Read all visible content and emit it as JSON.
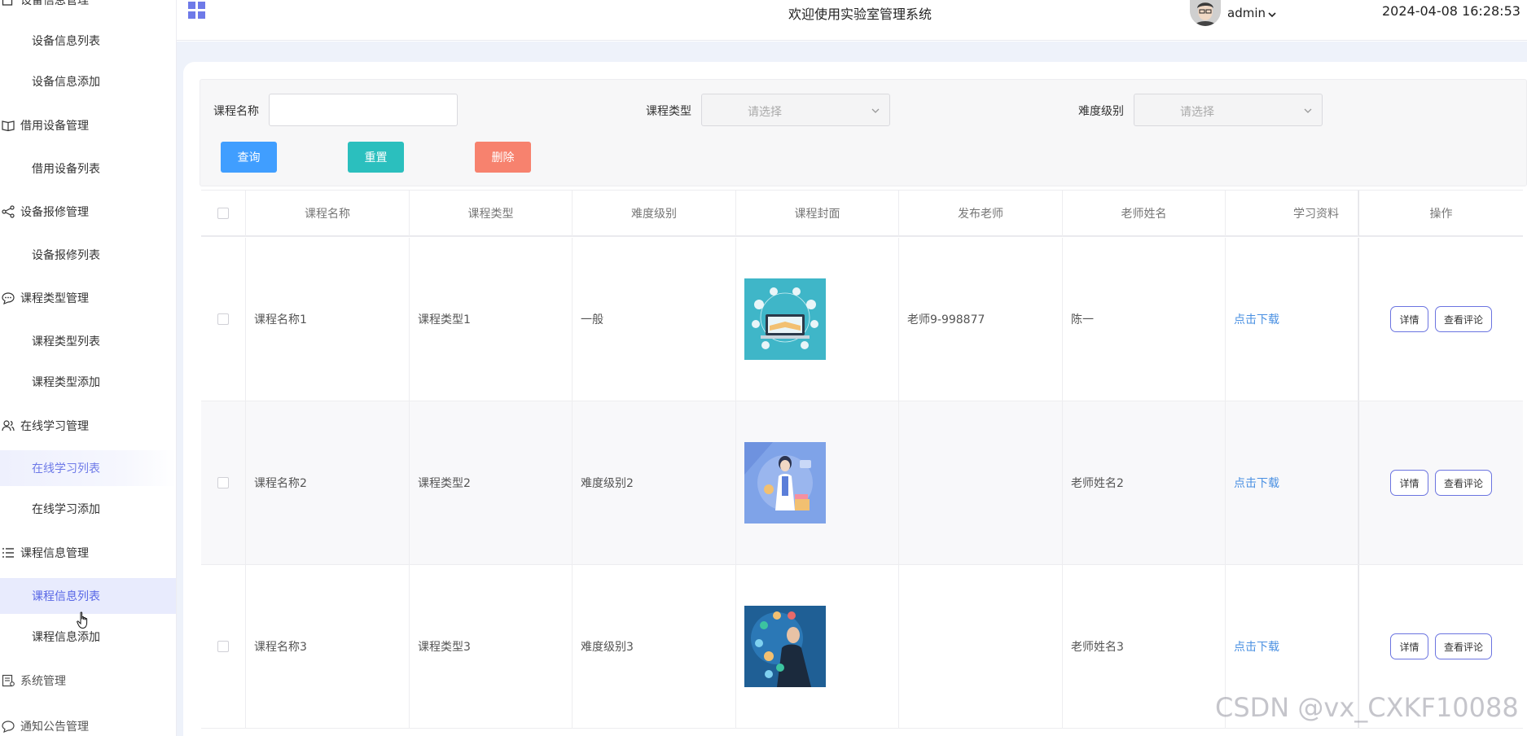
{
  "header": {
    "title": "欢迎使用实验室管理系统",
    "user": "admin",
    "datetime": "2024-04-08 16:28:53"
  },
  "sidebar": {
    "groups": [
      {
        "label": "设备信息管理",
        "icon": "device-icon",
        "items": [
          "设备信息列表",
          "设备信息添加"
        ]
      },
      {
        "label": "借用设备管理",
        "icon": "book-icon",
        "items": [
          "借用设备列表"
        ]
      },
      {
        "label": "设备报修管理",
        "icon": "share-icon",
        "items": [
          "设备报修列表"
        ]
      },
      {
        "label": "课程类型管理",
        "icon": "chat-icon",
        "items": [
          "课程类型列表",
          "课程类型添加"
        ]
      },
      {
        "label": "在线学习管理",
        "icon": "users-icon",
        "items": [
          "在线学习列表",
          "在线学习添加"
        ]
      },
      {
        "label": "课程信息管理",
        "icon": "list-icon",
        "items": [
          "课程信息列表",
          "课程信息添加"
        ]
      },
      {
        "label": "系统管理",
        "icon": "doc-icon",
        "items": []
      },
      {
        "label": "通知公告管理",
        "icon": "message-icon",
        "items": []
      }
    ],
    "hovered_item": "在线学习列表",
    "active_item": "课程信息列表"
  },
  "search": {
    "course_name_label": "课程名称",
    "course_name_value": "",
    "course_type_label": "课程类型",
    "course_type_placeholder": "请选择",
    "difficulty_label": "难度级别",
    "difficulty_placeholder": "请选择",
    "query_button": "查询",
    "reset_button": "重置",
    "delete_button": "删除"
  },
  "colors": {
    "accent": "#6e7ae8",
    "query": "#409eff",
    "reset": "#2bbfbe",
    "delete": "#f7826e",
    "link": "#4a90e2"
  },
  "table": {
    "columns": [
      "课程名称",
      "课程类型",
      "难度级别",
      "课程封面",
      "发布老师",
      "老师姓名",
      "学习资料",
      "操作"
    ],
    "rows": [
      {
        "name": "课程名称1",
        "type": "课程类型1",
        "level": "一般",
        "cover": "cover-laptop-books",
        "publisher": "老师9-998877",
        "teacher": "陈一",
        "material": "点击下载",
        "detail": "详情",
        "comments": "查看评论"
      },
      {
        "name": "课程名称2",
        "type": "课程类型2",
        "level": "难度级别2",
        "cover": "cover-teacher-girl",
        "publisher": "",
        "teacher": "老师姓名2",
        "material": "点击下载",
        "detail": "详情",
        "comments": "查看评论"
      },
      {
        "name": "课程名称3",
        "type": "课程类型3",
        "level": "难度级别3",
        "cover": "cover-business-icons",
        "publisher": "",
        "teacher": "老师姓名3",
        "material": "点击下载",
        "detail": "详情",
        "comments": "查看评论"
      }
    ]
  },
  "watermark": "CSDN @vx_CXKF10088"
}
